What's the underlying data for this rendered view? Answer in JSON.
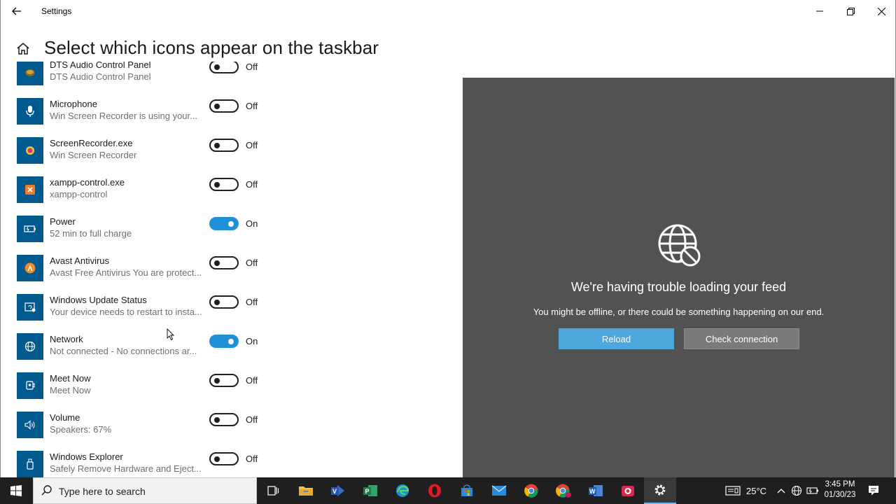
{
  "window": {
    "app_title": "Settings",
    "page_title": "Select which icons appear on the taskbar"
  },
  "icons": [
    {
      "name": "DTS Audio Control Panel",
      "desc": "DTS Audio Control Panel",
      "state": "Off",
      "on": false,
      "icon": "dts-audio-icon"
    },
    {
      "name": "Microphone",
      "desc": "Win Screen Recorder is using your...",
      "state": "Off",
      "on": false,
      "icon": "microphone-icon"
    },
    {
      "name": "ScreenRecorder.exe",
      "desc": "Win Screen Recorder",
      "state": "Off",
      "on": false,
      "icon": "screen-recorder-icon"
    },
    {
      "name": "xampp-control.exe",
      "desc": "xampp-control",
      "state": "Off",
      "on": false,
      "icon": "xampp-icon"
    },
    {
      "name": "Power",
      "desc": "52 min to full charge",
      "state": "On",
      "on": true,
      "icon": "battery-icon"
    },
    {
      "name": "Avast Antivirus",
      "desc": "Avast Free Antivirus You are protect...",
      "state": "Off",
      "on": false,
      "icon": "avast-icon"
    },
    {
      "name": "Windows Update Status",
      "desc": "Your device needs to restart to insta...",
      "state": "Off",
      "on": false,
      "icon": "windows-update-icon"
    },
    {
      "name": "Network",
      "desc": "Not connected - No connections ar...",
      "state": "On",
      "on": true,
      "icon": "globe-icon"
    },
    {
      "name": "Meet Now",
      "desc": "Meet Now",
      "state": "Off",
      "on": false,
      "icon": "meet-now-icon"
    },
    {
      "name": "Volume",
      "desc": "Speakers: 67%",
      "state": "Off",
      "on": false,
      "icon": "speaker-icon"
    },
    {
      "name": "Windows Explorer",
      "desc": "Safely Remove Hardware and Eject...",
      "state": "Off",
      "on": false,
      "icon": "usb-drive-icon"
    }
  ],
  "feed": {
    "title": "We're having trouble loading your feed",
    "subtitle": "You might be offline, or there could be something happening on our end.",
    "reload_label": "Reload",
    "check_label": "Check connection"
  },
  "taskbar": {
    "search_placeholder": "Type here to search",
    "temperature": "25°C",
    "time": "3:45 PM",
    "date": "01/30/23",
    "apps": [
      "task-view-icon",
      "file-explorer-icon",
      "visio-icon",
      "project-icon",
      "edge-icon",
      "opera-icon",
      "store-icon",
      "mail-icon",
      "chrome-icon",
      "chrome-profile-icon",
      "word-icon",
      "screen-recorder-icon",
      "settings-gear-icon"
    ]
  },
  "colors": {
    "accent": "#1f8fd6",
    "tile": "#005a8e",
    "feed_bg": "#525252",
    "reload": "#4ea8db"
  }
}
